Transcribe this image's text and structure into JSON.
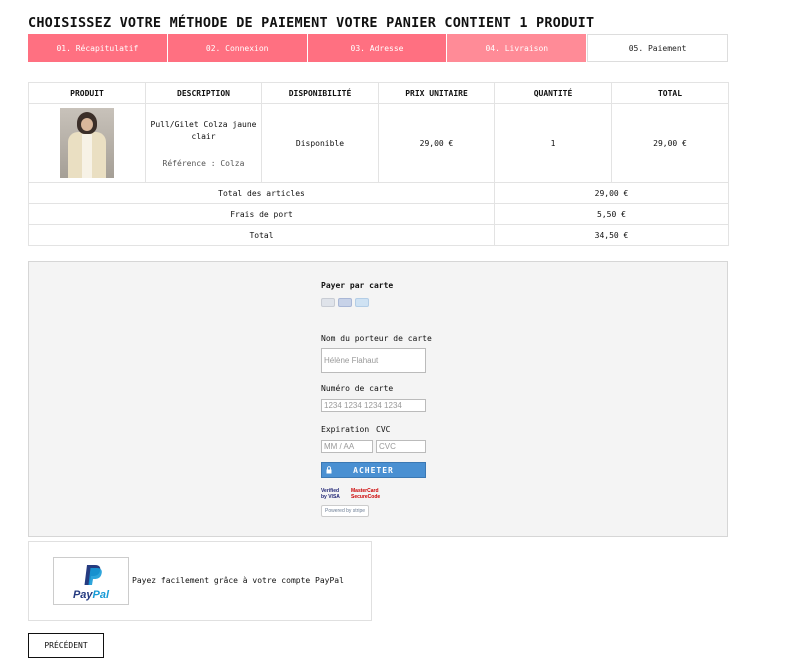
{
  "page": {
    "title": "CHOISISSEZ VOTRE MÉTHODE DE PAIEMENT VOTRE PANIER CONTIENT 1 PRODUIT"
  },
  "steps": [
    {
      "label": "01. Récapitulatif",
      "state": "done"
    },
    {
      "label": "02. Connexion",
      "state": "done"
    },
    {
      "label": "03. Adresse",
      "state": "done"
    },
    {
      "label": "04. Livraison",
      "state": "done"
    },
    {
      "label": "05. Paiement",
      "state": "current"
    }
  ],
  "cart": {
    "headers": [
      "PRODUIT",
      "DESCRIPTION",
      "DISPONIBILITÉ",
      "PRIX UNITAIRE",
      "QUANTITÉ",
      "TOTAL"
    ],
    "item": {
      "name": "Pull/Gilet Colza jaune clair",
      "reference": "Référence : Colza",
      "availability": "Disponible",
      "unit_price": "29,00 €",
      "quantity": "1",
      "total": "29,00 €"
    },
    "summary": [
      {
        "label": "Total des articles",
        "value": "29,00 €"
      },
      {
        "label": "Frais de port",
        "value": "5,50 €"
      },
      {
        "label": "Total",
        "value": "34,50 €"
      }
    ]
  },
  "card_payment": {
    "title": "Payer par carte",
    "holder_label": "Nom du porteur de carte",
    "holder_placeholder": "Hélène Flahaut",
    "number_label": "Numéro de carte",
    "number_placeholder": "1234 1234 1234 1234",
    "expiry_label": "Expiration",
    "cvc_label": "CVC",
    "expiry_placeholder": "MM / AA",
    "cvc_placeholder": "CVC",
    "buy_label": "ACHETER",
    "verified_by_visa": "Verified by VISA",
    "mastercard_securecode": "MasterCard SecureCode",
    "powered_by_stripe": "Powered by stripe"
  },
  "paypal": {
    "logo_text_1": "Pay",
    "logo_text_2": "Pal",
    "description": "Payez facilement grâce à votre compte PayPal"
  },
  "nav": {
    "previous_label": "PRÉCÉDENT"
  },
  "colors": {
    "step_done": "#ff7081",
    "accent_button": "#4a90d2",
    "paypal_dark": "#253b80",
    "paypal_light": "#179bd7"
  }
}
